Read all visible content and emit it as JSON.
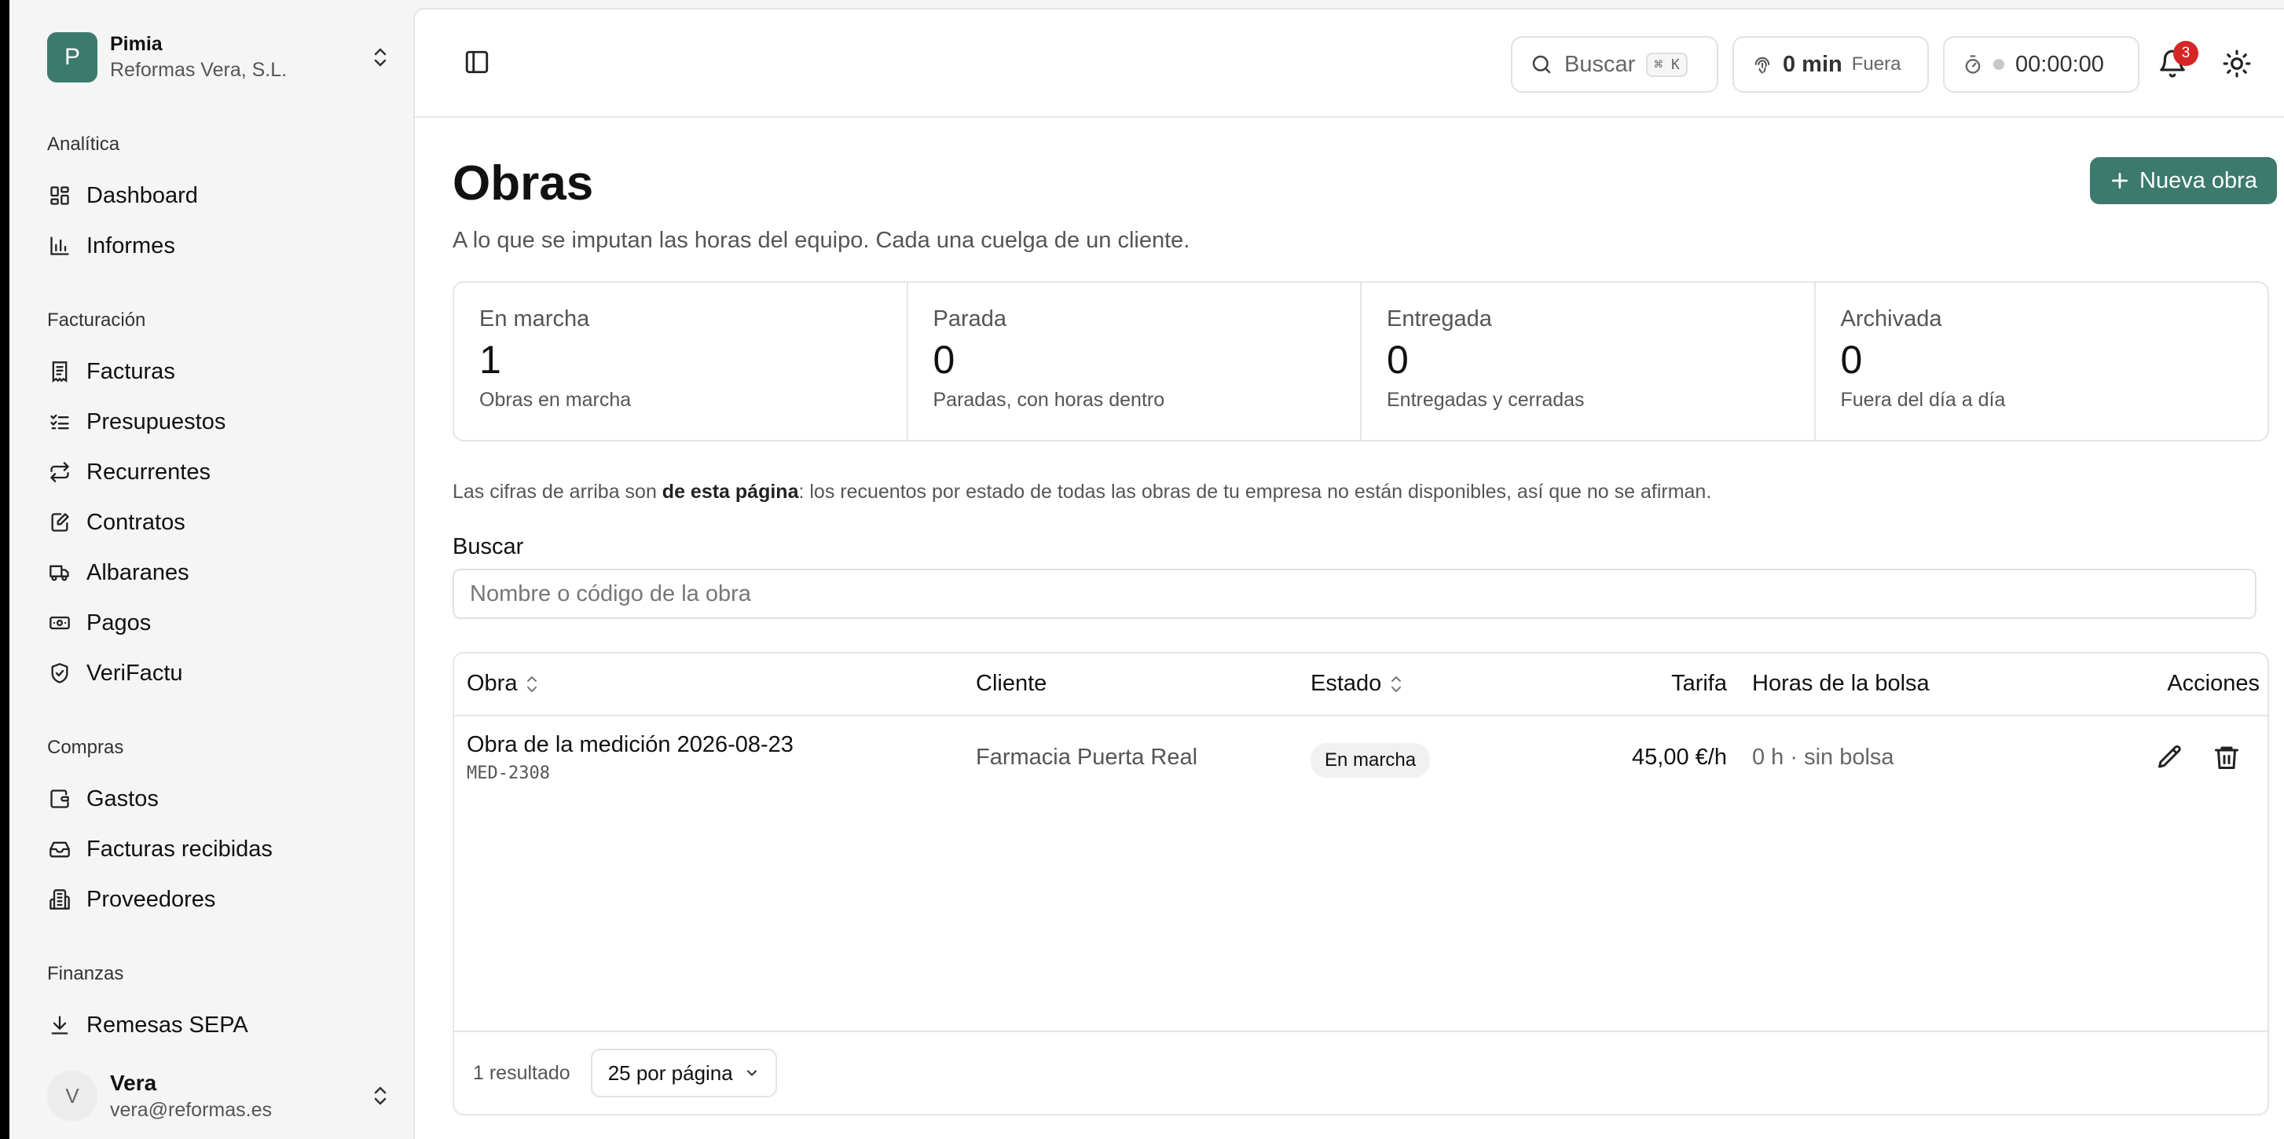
{
  "org": {
    "initial": "P",
    "name": "Pimia",
    "company": "Reformas Vera, S.L."
  },
  "sidebar": {
    "sections": [
      {
        "label": "Analítica",
        "items": [
          {
            "label": "Dashboard",
            "icon": "dashboard-icon"
          },
          {
            "label": "Informes",
            "icon": "bar-chart-icon"
          }
        ]
      },
      {
        "label": "Facturación",
        "items": [
          {
            "label": "Facturas",
            "icon": "receipt-icon"
          },
          {
            "label": "Presupuestos",
            "icon": "checklist-icon"
          },
          {
            "label": "Recurrentes",
            "icon": "repeat-icon"
          },
          {
            "label": "Contratos",
            "icon": "file-edit-icon"
          },
          {
            "label": "Albaranes",
            "icon": "truck-icon"
          },
          {
            "label": "Pagos",
            "icon": "banknote-icon"
          },
          {
            "label": "VeriFactu",
            "icon": "shield-check-icon"
          }
        ]
      },
      {
        "label": "Compras",
        "items": [
          {
            "label": "Gastos",
            "icon": "wallet-icon"
          },
          {
            "label": "Facturas recibidas",
            "icon": "inbox-icon"
          },
          {
            "label": "Proveedores",
            "icon": "building-icon"
          }
        ]
      },
      {
        "label": "Finanzas",
        "items": [
          {
            "label": "Remesas SEPA",
            "icon": "download-icon"
          }
        ]
      }
    ]
  },
  "user": {
    "initial": "V",
    "name": "Vera",
    "email": "vera@reformas.es"
  },
  "topbar": {
    "search_label": "Buscar",
    "search_shortcut": "⌘ K",
    "clock_time": "0 min",
    "clock_status": "Fuera",
    "timer": "00:00:00",
    "notifications_count": "3"
  },
  "page": {
    "title": "Obras",
    "subtitle": "A lo que se imputan las horas del equipo. Cada una cuelga de un cliente.",
    "new_button": "Nueva obra"
  },
  "stats": [
    {
      "label": "En marcha",
      "value": "1",
      "desc": "Obras en marcha"
    },
    {
      "label": "Parada",
      "value": "0",
      "desc": "Paradas, con horas dentro"
    },
    {
      "label": "Entregada",
      "value": "0",
      "desc": "Entregadas y cerradas"
    },
    {
      "label": "Archivada",
      "value": "0",
      "desc": "Fuera del día a día"
    }
  ],
  "note": {
    "prefix": "Las cifras de arriba son ",
    "bold": "de esta página",
    "suffix": ": los recuentos por estado de todas las obras de tu empresa no están disponibles, así que no se afirman."
  },
  "search": {
    "label": "Buscar",
    "placeholder": "Nombre o código de la obra",
    "value": ""
  },
  "table": {
    "headers": {
      "obra": "Obra",
      "cliente": "Cliente",
      "estado": "Estado",
      "tarifa": "Tarifa",
      "horas": "Horas de la bolsa",
      "acciones": "Acciones"
    },
    "rows": [
      {
        "name": "Obra de la medición 2026-08-23",
        "code": "MED-2308",
        "client": "Farmacia Puerta Real",
        "status": "En marcha",
        "rate": "45,00 €/h",
        "hours": "0 h · sin bolsa"
      }
    ],
    "footer": {
      "results": "1 resultado",
      "per_page": "25 por página"
    }
  }
}
